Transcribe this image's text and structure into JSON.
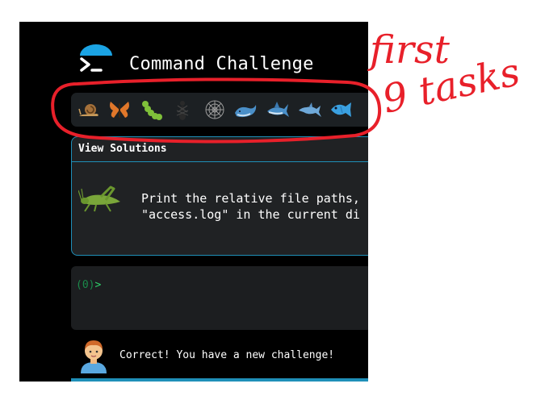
{
  "app": {
    "title": "Command Challenge"
  },
  "tasks": [
    {
      "name": "snail-icon"
    },
    {
      "name": "butterfly-icon"
    },
    {
      "name": "caterpillar-icon"
    },
    {
      "name": "ant-icon"
    },
    {
      "name": "spider-web-icon"
    },
    {
      "name": "whale-icon"
    },
    {
      "name": "shark-icon"
    },
    {
      "name": "dolphin-icon"
    },
    {
      "name": "fish-icon"
    }
  ],
  "solutions": {
    "label": "View Solutions"
  },
  "challenge": {
    "line1": "Print the relative file paths,",
    "line2": "\"access.log\" in the current di"
  },
  "terminal": {
    "prompt_number": "(0)",
    "prompt_arrow": ">"
  },
  "status": {
    "message": "Correct! You have a new challenge!"
  },
  "annotation": {
    "line1": "first",
    "line2": "9 tasks"
  },
  "colors": {
    "accent": "#1f8fb8",
    "annotation": "#e8202a",
    "prompt": "#2fd06a"
  }
}
